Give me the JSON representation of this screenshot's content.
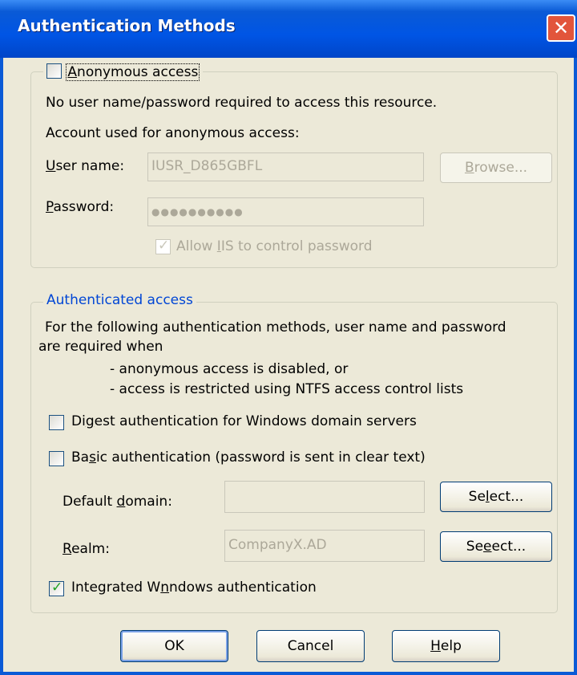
{
  "window": {
    "title": "Authentication Methods",
    "close_glyph": "✕"
  },
  "anonymous": {
    "checkbox_label": "Anonymous access",
    "description": "No user name/password required to access this resource.",
    "account_label": "Account used for anonymous access:",
    "user_name_label": "User name:",
    "user_name_value": "IUSR_D865GBFL",
    "browse_label": "Browse...",
    "password_label": "Password:",
    "password_value": "●●●●●●●●●●",
    "allow_iis_label": "Allow IIS to control password",
    "checked": false,
    "allow_iis_checked": true
  },
  "authenticated": {
    "legend": "Authenticated access",
    "desc_line1": "For the following authentication methods, user name and password",
    "desc_line2": "are required when",
    "bullet1": "- anonymous access is disabled, or",
    "bullet2": "- access is restricted using NTFS access control lists",
    "digest_label": "Digest authentication for Windows domain servers",
    "basic_label": "Basic authentication (password is sent in clear text)",
    "default_domain_label": "Default domain:",
    "default_domain_value": "",
    "select_label": "Select...",
    "realm_label": "Realm:",
    "realm_value": "CompanyX.AD",
    "integrated_label": "Integrated Windows authentication",
    "digest_checked": false,
    "basic_checked": false,
    "integrated_checked": true
  },
  "buttons": {
    "ok": "OK",
    "cancel": "Cancel",
    "help": "Help"
  },
  "colors": {
    "title_bar": "#0055e5",
    "client_bg": "#ece9d8",
    "legend_text": "#0046d5",
    "close_button": "#e2553b"
  }
}
